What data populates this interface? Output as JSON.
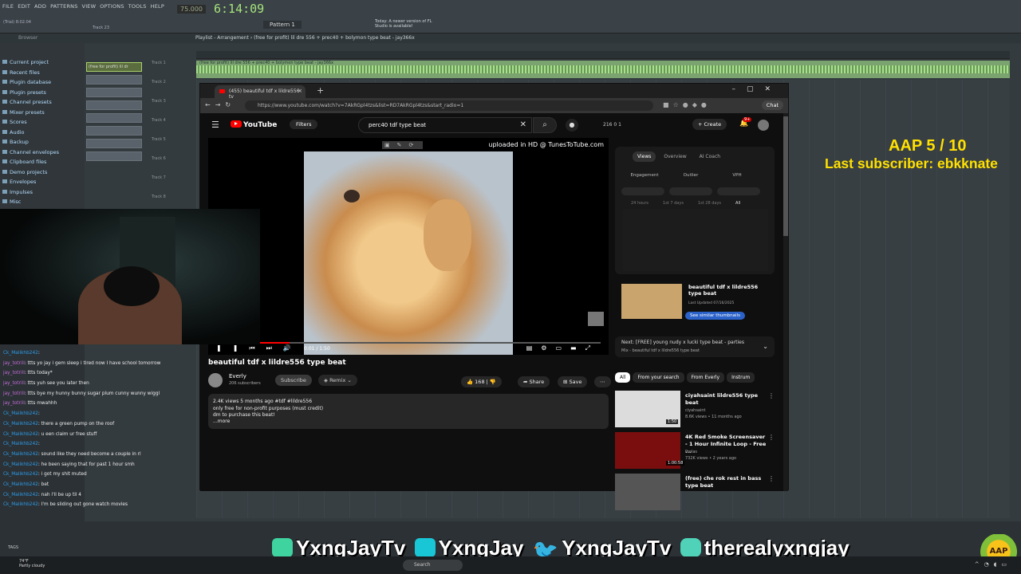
{
  "fl": {
    "menu": [
      "FILE",
      "EDIT",
      "ADD",
      "PATTERNS",
      "VIEW",
      "OPTIONS",
      "TOOLS",
      "HELP"
    ],
    "time": "6:14:09",
    "tempo": "75.000",
    "pattern": "Pattern 1",
    "news": "Today: A newer version of FL Studio is available!",
    "trial": "(Trial) 8:02:04",
    "track23": "Track 23",
    "browser_label": "Browser",
    "playlist_title": "Playlist - Arrangement › (free for profit) lil dre 556 + prec40 + bolymon type beat - jay366x",
    "clip_label": "(free for profit) lil dre 556 + prec40 + bolymon type beat - jay366x",
    "browser_items": [
      "Current project",
      "Recent files",
      "Plugin database",
      "Plugin presets",
      "Channel presets",
      "Mixer presets",
      "Scores",
      "Audio",
      "Backup",
      "Channel envelopes",
      "Clipboard files",
      "Demo projects",
      "Envelopes",
      "Impulses",
      "Misc",
      "My FL Studio Web projects"
    ],
    "pattern_clip": "(free for profit) lil dr",
    "tracks": [
      "Track 1",
      "Track 2",
      "Track 3",
      "Track 4",
      "Track 5",
      "Track 6",
      "Track 7",
      "Track 8"
    ]
  },
  "chrome": {
    "tab_title": "(455) beautiful tdf x lildre556 ty",
    "url": "https://www.youtube.com/watch?v=7AkRGpl4tzs&list=RD7AkRGpl4tzs&start_radio=1",
    "chat_label": "Chat"
  },
  "yt": {
    "logo": "YouTube",
    "filters": "Filters",
    "search_query": "perc40 tdf type beat",
    "stats": "216  0  1",
    "create": "Create",
    "notif_count": "9+",
    "overlay": "uploaded in HD @ TunesToTube.com",
    "time": "0:01 / 1:50",
    "progress": 0.19,
    "video_title": "beautiful tdf x lildre556 type beat",
    "channel": "Everly",
    "subs": "206 subscribers",
    "subscribe": "Subscribe",
    "remix": "Remix",
    "likes": "168",
    "share": "Share",
    "save": "Save",
    "desc_meta": "2.4K views  5 months ago  #tdf #lildre556",
    "desc_line1": "only free for non-profit purposes (must credit)",
    "desc_line2": "dm to purchase this beat!",
    "desc_more": "...more",
    "analytics": {
      "tabs": [
        "Views",
        "Overview",
        "AI Coach"
      ],
      "metrics": [
        "Engagement",
        "Outlier",
        "VPH"
      ],
      "ranges": [
        "24 hours",
        "1st 7 days",
        "1st 28 days",
        "All"
      ]
    },
    "similar": {
      "title": "beautiful tdf x lildre556 type beat",
      "sub": "Last Updated 07/16/2025",
      "btn": "See similar thumbnails"
    },
    "next": {
      "label": "Next: [FREE] young nudy x lucki type beat - parties",
      "sub": "Mix - beautiful tdf x lildre556 type beat"
    },
    "chips": [
      "All",
      "From your search",
      "From Everly",
      "Instrum"
    ],
    "recs": [
      {
        "title": "ciyahsaint lildre556 type beat",
        "m1": "ciyahsaint",
        "m2": "8.6K views • 11 months ago",
        "dur": "1:50",
        "color": "#dcdcdc"
      },
      {
        "title": "4K Red Smoke Screensaver - 1 Hour  Infinite Loop - Free ...",
        "m1": "Prolas",
        "m2": "732K views • 2 years ago",
        "dur": "1:00:58",
        "color": "#7a0e0e"
      },
      {
        "title": "(free) che rok rest in bass type beat",
        "m1": "",
        "m2": "",
        "dur": "",
        "color": "#555"
      }
    ]
  },
  "chat": [
    {
      "u": "Ck_Malikhb242",
      "t": ":",
      "jay": false
    },
    {
      "u": "jay_totrill",
      "t": ": ttts yo jay i gem sleep i tired now I have school tomorrow",
      "jay": true
    },
    {
      "u": "jay_totrill",
      "t": ": ttts today*",
      "jay": true
    },
    {
      "u": "jay_totrill",
      "t": ": ttts yuh see you later then",
      "jay": true
    },
    {
      "u": "jay_totrill",
      "t": ": ttts bye my hunny bunny sugar plum cunny wunny wiggl",
      "jay": true
    },
    {
      "u": "jay_totrill",
      "t": ": ttts mwahhh",
      "jay": true
    },
    {
      "u": "Ck_Malikhb242",
      "t": ":",
      "jay": false
    },
    {
      "u": "Ck_Malikhb242",
      "t": ": there a green pump on the roof",
      "jay": false
    },
    {
      "u": "Ck_Malikhb242",
      "t": ": u een claim ur free stuff",
      "jay": false
    },
    {
      "u": "Ck_Malikhb242",
      "t": ":",
      "jay": false
    },
    {
      "u": "Ck_Malikhb242",
      "t": ": sound like they need become a couple in rl",
      "jay": false
    },
    {
      "u": "Ck_Malikhb242",
      "t": ": he been saying that for past 1 hour smh",
      "jay": false
    },
    {
      "u": "Ck_Malikhb242",
      "t": ": i got my shit muted",
      "jay": false
    },
    {
      "u": "Ck_Malikhb242",
      "t": ": bet",
      "jay": false
    },
    {
      "u": "Ck_Malikhb242",
      "t": ": nah i'll be up til 4",
      "jay": false
    },
    {
      "u": "Ck_Malikhb242",
      "t": ": I'm be sliding out gone watch movies",
      "jay": false
    }
  ],
  "overlay": {
    "aap": "AAP 5 / 10",
    "last_sub": "Last subscriber: ebkknate",
    "tags": "TAGS",
    "socials": [
      "YxngJayTv",
      "YxngJay",
      "YxngJayTv",
      "therealyxngjay"
    ],
    "logo": "AAP"
  },
  "taskbar": {
    "temp": "74°F",
    "weather": "Partly cloudy",
    "search": "Search"
  }
}
